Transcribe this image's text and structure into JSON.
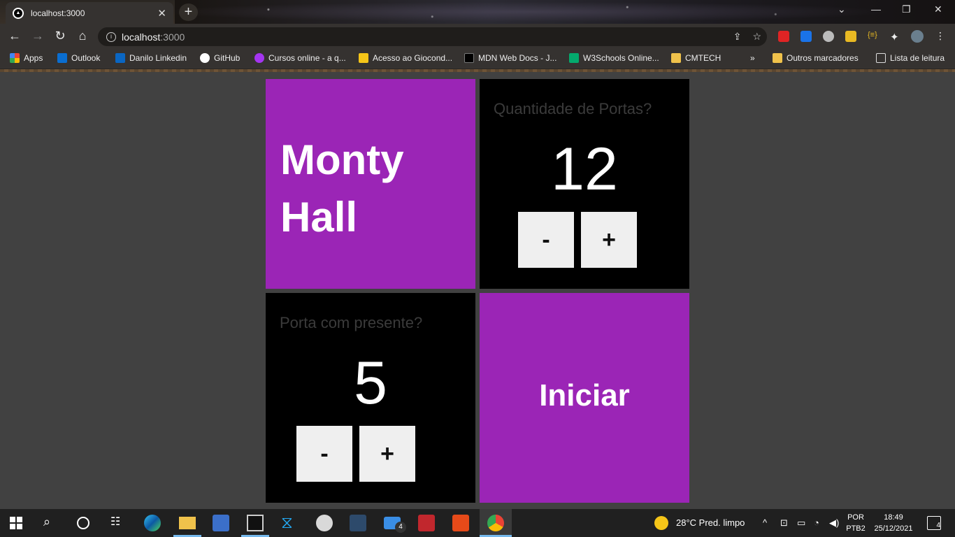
{
  "browser": {
    "tab_title": "localhost:3000",
    "url_host": "localhost",
    "url_port": ":3000",
    "bookmarks": [
      {
        "label": "Apps",
        "icon": "apps-grid-icon",
        "color": "#e8453c"
      },
      {
        "label": "Outlook",
        "icon": "outlook-icon",
        "color": "#0a6ed1"
      },
      {
        "label": "Danilo Linkedin",
        "icon": "linkedin-icon",
        "color": "#0a66c2"
      },
      {
        "label": "GitHub",
        "icon": "github-icon",
        "color": "#ffffff"
      },
      {
        "label": "Cursos online - a q...",
        "icon": "udemy-icon",
        "color": "#a435f0"
      },
      {
        "label": "Acesso ao Giocond...",
        "icon": "chart-icon",
        "color": "#f5c518"
      },
      {
        "label": "MDN Web Docs - J...",
        "icon": "mdn-icon",
        "color": "#000000"
      },
      {
        "label": "W3Schools Online...",
        "icon": "w3schools-icon",
        "color": "#04aa6d"
      },
      {
        "label": "CMTECH",
        "icon": "folder-icon",
        "color": "#f0c24b"
      }
    ],
    "other_bookmarks": "Outros marcadores",
    "reading_list": "Lista de leitura"
  },
  "game": {
    "title_line1": "Monty",
    "title_line2": "Hall",
    "doors_label": "Quantidade de Portas?",
    "doors_value": "12",
    "gift_label": "Porta com presente?",
    "gift_value": "5",
    "minus_label": "-",
    "plus_label": "+",
    "start_label": "Iniciar",
    "accent_color": "#9b25b6"
  },
  "taskbar": {
    "weather": "28°C  Pred. limpo",
    "lang_top": "POR",
    "lang_bottom": "PTB2",
    "time": "18:49",
    "date": "25/12/2021",
    "notifications": "4",
    "mail_badge": "4"
  }
}
